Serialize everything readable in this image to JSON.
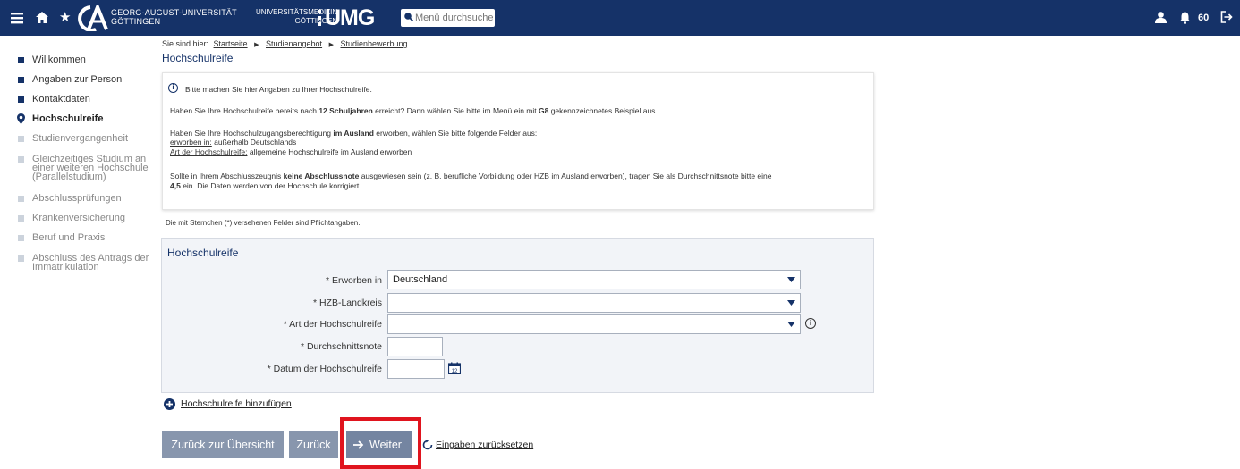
{
  "header": {
    "university_text_line1": "GEORG-AUGUST-UNIVERSITÄT",
    "university_text_line2": "GÖTTINGEN",
    "umg_text_line1": "UNIVERSITÄTSMEDIZIN",
    "umg_text_line2": "GÖTTINGEN",
    "umg_logo": "UMG",
    "search_placeholder": "Menü durchsuche",
    "notification_count": "60",
    "colors": {
      "bar": "#153268"
    }
  },
  "nav": {
    "items": [
      {
        "label": "Willkommen",
        "state": "done"
      },
      {
        "label": "Angaben zur Person",
        "state": "done"
      },
      {
        "label": "Kontaktdaten",
        "state": "done"
      },
      {
        "label": "Hochschulreife",
        "state": "current"
      },
      {
        "label": "Studienvergangenheit",
        "state": "pending"
      },
      {
        "label": "Gleichzeitiges Studium an einer weiteren Hochschule (Parallelstudium)",
        "state": "pending"
      },
      {
        "label": "Abschlussprüfungen",
        "state": "pending"
      },
      {
        "label": "Krankenversicherung",
        "state": "pending"
      },
      {
        "label": "Beruf und Praxis",
        "state": "pending"
      },
      {
        "label": "Abschluss des Antrags der Immatrikulation",
        "state": "pending"
      }
    ]
  },
  "breadcrumb": {
    "prefix": "Sie sind hier:",
    "items": [
      "Startseite",
      "Studienangebot",
      "Studienbewerbung"
    ]
  },
  "page": {
    "title": "Hochschulreife"
  },
  "info": {
    "intro": "Bitte machen Sie hier Angaben zu Ihrer Hochschulreife.",
    "g8_a": "Haben Sie Ihre Hochschulreife bereits nach ",
    "g8_b": "12 Schuljahren",
    "g8_c": " erreicht? Dann wählen Sie bitte im Menü ein mit ",
    "g8_d": "G8",
    "g8_e": " gekennzeichnetes Beispiel aus.",
    "abroad_a": "Haben Sie Ihre Hochschulzugangsberechtigung ",
    "abroad_b": "im Ausland",
    "abroad_c": " erworben, wählen Sie bitte folgende Felder aus:",
    "abroad_f1_label": "erworben in:",
    "abroad_f1_value": " außerhalb Deutschlands",
    "abroad_f2_label": "Art der Hochschulreife:",
    "abroad_f2_value": " allgemeine Hochschulreife im Ausland erworben",
    "grade_a": "Sollte in Ihrem Abschlusszeugnis ",
    "grade_b": "keine Abschlussnote",
    "grade_c": " ausgewiesen sein (z. B. berufliche Vorbildung oder HZB im Ausland erworben), tragen Sie als Durchschnittsnote bitte eine",
    "grade_d": "4,5",
    "grade_e": " ein. Die Daten werden von der Hochschule korrigiert."
  },
  "required_note": "Die mit Sternchen (*) versehenen Felder sind Pflichtangaben.",
  "form": {
    "title": "Hochschulreife",
    "erworben_in": {
      "label": "* Erworben in",
      "value": "Deutschland"
    },
    "landkreis": {
      "label": "* HZB-Landkreis",
      "value": ""
    },
    "art": {
      "label": "* Art der Hochschulreife",
      "value": ""
    },
    "note": {
      "label": "* Durchschnittsnote",
      "value": ""
    },
    "datum": {
      "label": "* Datum der Hochschulreife",
      "value": ""
    },
    "calendar_day": "12"
  },
  "add_link": "Hochschulreife hinzufügen",
  "buttons": {
    "overview": "Zurück zur Übersicht",
    "back": "Zurück",
    "next": "Weiter",
    "reset": "Eingaben zurücksetzen"
  }
}
